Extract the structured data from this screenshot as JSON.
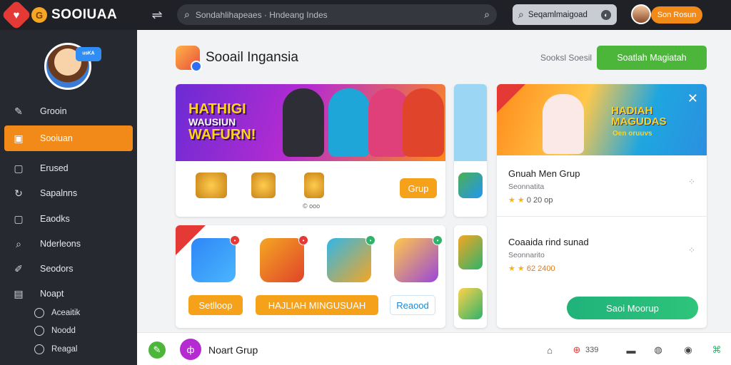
{
  "app": {
    "name": "SOOIUAA",
    "logo_icon": "heart-icon",
    "coin_glyph": "G"
  },
  "topbar": {
    "search_placeholder": "Sondahlihapeaes · Hndeang Indes",
    "search2_text": "Seqamlmaigoad",
    "button_label": "Son Rosun"
  },
  "sidebar": {
    "badge": "ᵘˢᴷᴬ",
    "items": [
      {
        "label": "Grooin",
        "icon": "pin-icon"
      },
      {
        "label": "Sooiuan",
        "icon": "chat-icon",
        "active": true
      },
      {
        "label": "Erused",
        "icon": "square-icon"
      },
      {
        "label": "Sapalnns",
        "icon": "share-icon"
      },
      {
        "label": "Eaodks",
        "icon": "edit-icon"
      },
      {
        "label": "Nderleons",
        "icon": "search-icon"
      },
      {
        "label": "Seodors",
        "icon": "star-icon"
      },
      {
        "label": "Noapt",
        "icon": "folder-icon"
      }
    ],
    "subitems": [
      "Aceaitik",
      "Noodd",
      "Reagal"
    ]
  },
  "main": {
    "title": "Sooail Ingansia",
    "link": "Sooksl Soesil",
    "cta": "Soatlah Magiatah",
    "hero_text_line1": "HATHIGI",
    "hero_text_line2": "WAUSIUN",
    "hero_text_line3": "WAFURN!",
    "grup_button": "Grup",
    "hero_caption": "© ooo",
    "game_row": {
      "buttons": [
        "Setlloop",
        "HAJLIAH MINGUSUAH",
        "Reaood"
      ]
    }
  },
  "panel": {
    "head_text": "HADIAH MAGUDAS",
    "head_sub": "Oen oruuvs",
    "groups": [
      {
        "name": "Gnuah Men Grup",
        "sub": "Seonnatita",
        "rating": "0 20 op"
      },
      {
        "name": "Coaaida rind sunad",
        "sub": "Seonnarito",
        "rating": "62 2400"
      }
    ],
    "cta": "Saoi Moorup"
  },
  "bottombar": {
    "label": "Noart Grup",
    "count": "339"
  },
  "colors": {
    "accent": "#f28a1a",
    "green": "#4cb63a",
    "teal": "#1fb37a"
  }
}
